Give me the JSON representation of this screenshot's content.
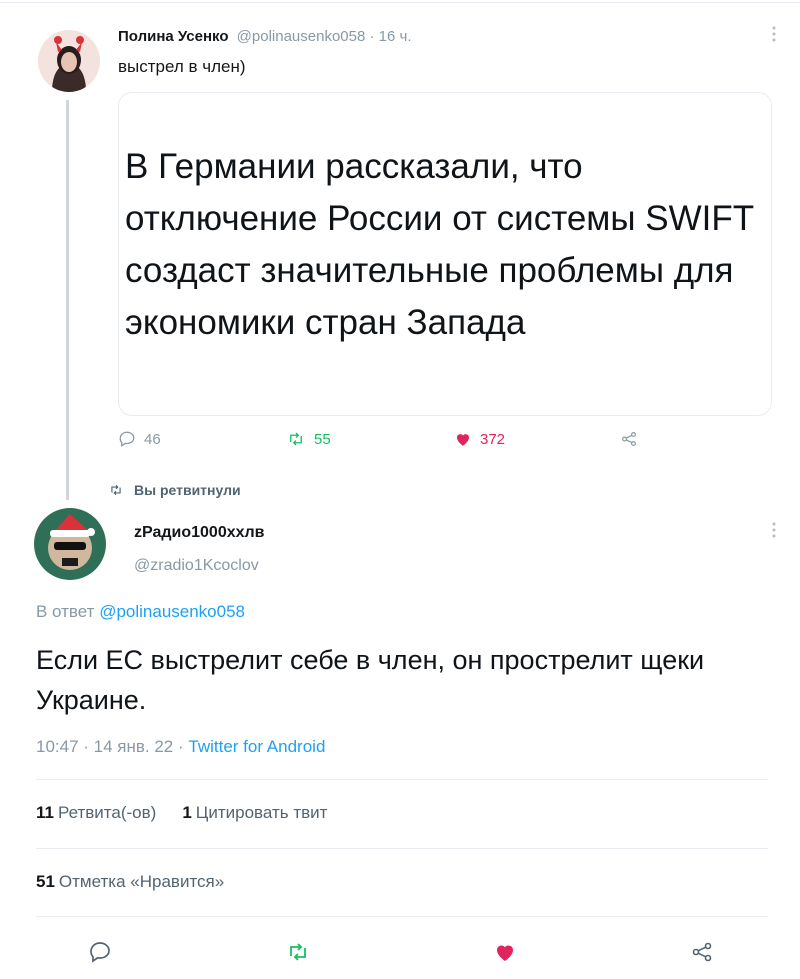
{
  "tweet1": {
    "name": "Полина Усенко",
    "meta": "@polinausenko058 · 16 ч.",
    "text": "выстрел в член)",
    "card_text": "В Германии рассказали, что отключение России от системы SWIFT создаст значительные проблемы для экономики стран Запада",
    "replies": "46",
    "retweets": "55",
    "likes": "372"
  },
  "retweeted_label": "Вы ретвитнули",
  "tweet2": {
    "name": "zРадио1000ххлв",
    "handle": "@zradio1Kcoclov",
    "reply_prefix": "В ответ",
    "reply_handle": "@polinausenko058",
    "text": "Если ЕС выстрелит себе в член, он прострелит щеки Украине.",
    "time": "10:47 · 14 янв. 22 ·",
    "source": "Twitter for Android",
    "retweets_count": "11",
    "retweets_label": "Ретвита(-ов)",
    "quotes_count": "1",
    "quotes_label": "Цитировать твит",
    "likes_count": "51",
    "likes_label": "Отметка «Нравится»"
  },
  "icons": {
    "reply": "reply-icon",
    "retweet": "retweet-icon",
    "like": "heart-icon",
    "share": "share-icon",
    "more": "more-icon"
  },
  "colors": {
    "accent_blue": "#1da1f2",
    "retweet_green": "#17bf63",
    "like_red": "#e0245e",
    "muted": "#8899a6"
  }
}
